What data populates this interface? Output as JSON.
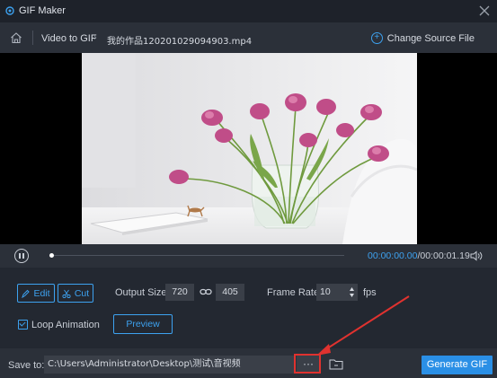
{
  "window": {
    "title": "GIF Maker"
  },
  "breadcrumb": {
    "root": "Video to GIF",
    "file": "我的作品120201029094903.mp4"
  },
  "header": {
    "change_source": "Change Source File"
  },
  "playback": {
    "current_time": "00:00:00.00",
    "total_time": "/00:00:01.19",
    "progress": 0.0
  },
  "toolbar": {
    "edit_label": "Edit",
    "cut_label": "Cut"
  },
  "output": {
    "label": "Output Size:",
    "width": "720",
    "height": "405"
  },
  "frame_rate": {
    "label": "Frame Rate:",
    "value": "10",
    "unit": "fps"
  },
  "options": {
    "loop_label": "Loop Animation",
    "loop_checked": true,
    "preview_label": "Preview"
  },
  "save": {
    "label": "Save to:",
    "path": "C:\\Users\\Administrator\\Desktop\\测试\\音视频",
    "browse_label": "···"
  },
  "actions": {
    "generate_label": "Generate GIF"
  },
  "colors": {
    "accent": "#3da2f0",
    "generate": "#2a8fe6",
    "annotation": "#e0322f"
  },
  "icons": [
    "gif-maker-logo-icon",
    "close-icon",
    "home-icon",
    "plus-circle-icon",
    "pause-icon",
    "volume-icon",
    "edit-icon",
    "scissors-icon",
    "link-icon",
    "spin-arrows-icon",
    "checkbox-icon",
    "folder-icon"
  ]
}
